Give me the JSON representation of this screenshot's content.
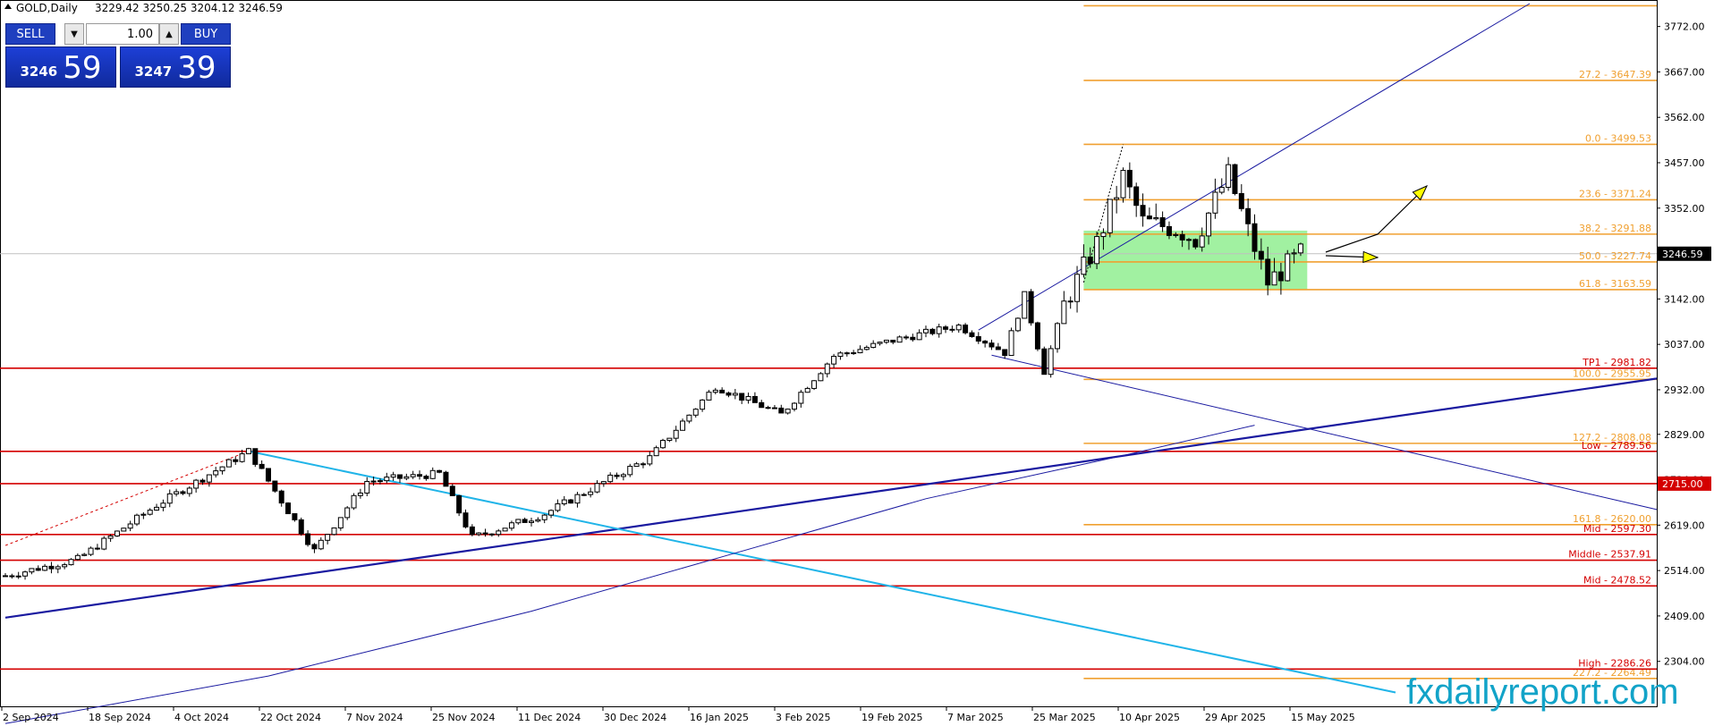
{
  "header": {
    "symbol_timeframe": "GOLD,Daily",
    "ohlc": "3229.42 3250.25 3204.12 3246.59",
    "collapse_icon": "triangle-up-icon"
  },
  "trade_panel": {
    "sell_label": "SELL",
    "buy_label": "BUY",
    "lot_value": "1.00",
    "bid_small": "3246",
    "bid_big": "59",
    "ask_small": "3247",
    "ask_big": "39",
    "colors": {
      "button": "#1f3fbf",
      "price_box": "#1a36c4"
    }
  },
  "watermark": "fxdailyreport.com",
  "chart_data": {
    "type": "candlestick",
    "symbol": "GOLD",
    "timeframe": "Daily",
    "ylim": [
      2200,
      3825
    ],
    "y_ticks": [
      "3772.00",
      "3667.00",
      "3562.00",
      "3457.00",
      "3352.00",
      "3247.00",
      "3142.00",
      "3037.00",
      "2932.00",
      "2829.00",
      "2724.00",
      "2619.00",
      "2514.00",
      "2409.00",
      "2304.00"
    ],
    "x_labels": [
      "2 Sep 2024",
      "18 Sep 2024",
      "4 Oct 2024",
      "22 Oct 2024",
      "7 Nov 2024",
      "25 Nov 2024",
      "11 Dec 2024",
      "30 Dec 2024",
      "16 Jan 2025",
      "3 Feb 2025",
      "19 Feb 2025",
      "7 Mar 2025",
      "25 Mar 2025",
      "10 Apr 2025",
      "29 Apr 2025",
      "15 May 2025"
    ],
    "current_price": "3246.59",
    "current_price_value": 3246.59,
    "marked_level": "2715.00",
    "marked_level_value": 2715.0,
    "key_points": [
      [
        0,
        2502
      ],
      [
        11,
        2540
      ],
      [
        23,
        2665
      ],
      [
        37,
        2790
      ],
      [
        47,
        2560
      ],
      [
        55,
        2720
      ],
      [
        66,
        2738
      ],
      [
        71,
        2590
      ],
      [
        82,
        2645
      ],
      [
        98,
        2775
      ],
      [
        108,
        2940
      ],
      [
        118,
        2875
      ],
      [
        126,
        3010
      ],
      [
        136,
        3050
      ],
      [
        145,
        3080
      ],
      [
        152,
        3018
      ],
      [
        155,
        3150
      ],
      [
        158,
        2975
      ],
      [
        161,
        3128
      ],
      [
        166,
        3270
      ],
      [
        170,
        3425
      ],
      [
        173,
        3320
      ],
      [
        178,
        3305
      ],
      [
        181,
        3280
      ],
      [
        186,
        3430
      ],
      [
        189,
        3300
      ],
      [
        192,
        3180
      ],
      [
        197,
        3246
      ]
    ],
    "moving_average": [
      [
        0,
        2160
      ],
      [
        40,
        2270
      ],
      [
        80,
        2420
      ],
      [
        110,
        2550
      ],
      [
        140,
        2680
      ],
      [
        170,
        2780
      ],
      [
        190,
        2850
      ]
    ],
    "horizontal_levels": [
      {
        "label": "TP1 - 2981.82",
        "value": 2981.82,
        "color": "#d40000",
        "from": "left"
      },
      {
        "label": "Low - 2789.56",
        "value": 2789.56,
        "color": "#d40000",
        "from": "left"
      },
      {
        "label": "",
        "value": 2715.0,
        "color": "#d40000",
        "from": "left"
      },
      {
        "label": "Mid - 2597.30",
        "value": 2597.3,
        "color": "#d40000",
        "from": "left"
      },
      {
        "label": "Middle - 2537.91",
        "value": 2537.91,
        "color": "#d40000",
        "from": "left"
      },
      {
        "label": "Mid - 2478.52",
        "value": 2478.52,
        "color": "#d40000",
        "from": "left"
      },
      {
        "label": "High - 2286.26",
        "value": 2286.26,
        "color": "#d40000",
        "from": "left"
      }
    ],
    "fibonacci_levels": [
      {
        "label": "",
        "value": 3820.0
      },
      {
        "label": "27.2 - 3647.39",
        "value": 3647.39
      },
      {
        "label": "0.0 - 3499.53",
        "value": 3499.53
      },
      {
        "label": "23.6 - 3371.24",
        "value": 3371.24
      },
      {
        "label": "38.2 - 3291.88",
        "value": 3291.88
      },
      {
        "label": "50.0 - 3227.74",
        "value": 3227.74
      },
      {
        "label": "61.8 - 3163.59",
        "value": 3163.59
      },
      {
        "label": "100.0 - 2955.95",
        "value": 2955.95
      },
      {
        "label": "127.2 - 2808.08",
        "value": 2808.08
      },
      {
        "label": "161.8 - 2620.00",
        "value": 2620.0
      },
      {
        "label": "227.2 - 2264.49",
        "value": 2264.49
      }
    ],
    "zone": {
      "from_bar": 164,
      "to_bar": 198,
      "low": 3163.59,
      "high": 3300.0
    },
    "colors": {
      "fib": "#f0a030",
      "level": "#d40000",
      "zone": "#90ee90",
      "trend": "#1a1aa0",
      "trend_light": "#20b4e8",
      "ma": "#1a1aa0",
      "arrow": "#ffff00"
    }
  }
}
